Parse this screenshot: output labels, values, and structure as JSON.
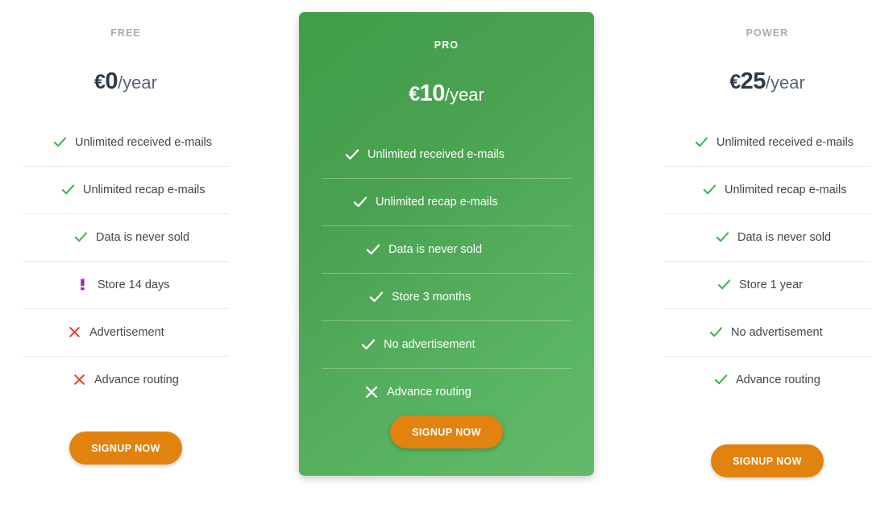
{
  "colors": {
    "check_green": "#35b34a",
    "cross_red": "#f03a2e",
    "warn_purple": "#9c27b0",
    "button_orange": "#e2820f",
    "featured_green_dark": "#3f9e48",
    "featured_green_light": "#62bb6a",
    "plan_name_gray": "#a9adb3",
    "price_navy": "#2d3a4a",
    "divider_gray": "#e9e9ea"
  },
  "plans": [
    {
      "name": "FREE",
      "currency": "€",
      "amount": "0",
      "period": "/year",
      "featured": false,
      "button_label": "SIGNUP NOW",
      "features": [
        {
          "icon": "check-icon",
          "label": "Unlimited received e-mails"
        },
        {
          "icon": "check-icon",
          "label": "Unlimited recap e-mails"
        },
        {
          "icon": "check-icon",
          "label": "Data is never sold"
        },
        {
          "icon": "warning-icon",
          "label": "Store 14 days"
        },
        {
          "icon": "cross-icon",
          "label": "Advertisement"
        },
        {
          "icon": "cross-icon",
          "label": "Advance routing"
        }
      ]
    },
    {
      "name": "PRO",
      "currency": "€",
      "amount": "10",
      "period": "/year",
      "featured": true,
      "button_label": "SIGNUP NOW",
      "features": [
        {
          "icon": "check-icon",
          "label": "Unlimited received e-mails"
        },
        {
          "icon": "check-icon",
          "label": "Unlimited recap e-mails"
        },
        {
          "icon": "check-icon",
          "label": "Data is never sold"
        },
        {
          "icon": "check-icon",
          "label": "Store 3 months"
        },
        {
          "icon": "check-icon",
          "label": "No advertisement"
        },
        {
          "icon": "cross-icon",
          "label": "Advance routing"
        }
      ]
    },
    {
      "name": "POWER",
      "currency": "€",
      "amount": "25",
      "period": "/year",
      "featured": false,
      "button_label": "SIGNUP NOW",
      "features": [
        {
          "icon": "check-icon",
          "label": "Unlimited received e-mails"
        },
        {
          "icon": "check-icon",
          "label": "Unlimited recap e-mails"
        },
        {
          "icon": "check-icon",
          "label": "Data is never sold"
        },
        {
          "icon": "check-icon",
          "label": "Store 1 year"
        },
        {
          "icon": "check-icon",
          "label": "No advertisement"
        },
        {
          "icon": "check-icon",
          "label": "Advance routing"
        }
      ]
    }
  ]
}
